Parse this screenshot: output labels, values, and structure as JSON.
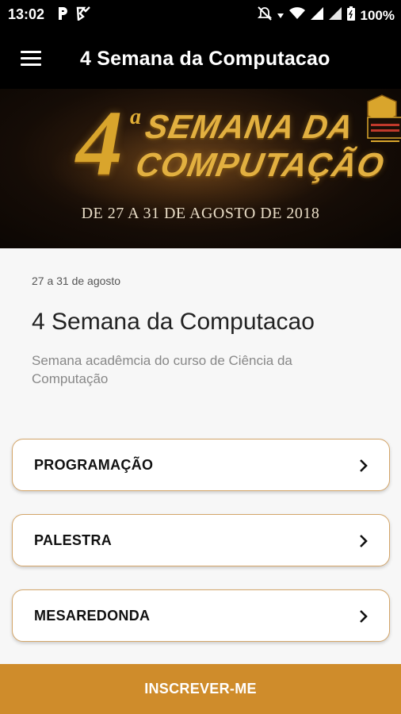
{
  "status_bar": {
    "time": "13:02",
    "left_icons": [
      "parking-icon",
      "notification-check-icon"
    ],
    "battery_text": "100%"
  },
  "app_bar": {
    "title": "4 Semana da Computacao",
    "menu_icon": "hamburger-menu-icon"
  },
  "banner": {
    "number": "4",
    "superscript": "a",
    "line1": "SEMANA DA",
    "line2": "COMPUTAÇÃO",
    "date_text": "DE 27 A 31 DE AGOSTO DE 2018"
  },
  "event": {
    "date": "27 a 31 de agosto",
    "title": "4 Semana da Computacao",
    "description": "Semana acadêmcia do curso de Ciência da Computação"
  },
  "menu": {
    "items": [
      {
        "label": "PROGRAMAÇÃO"
      },
      {
        "label": "PALESTRA"
      },
      {
        "label": "MESAREDONDA"
      }
    ]
  },
  "cta": {
    "label": "INSCREVER-ME"
  },
  "colors": {
    "accent": "#cf8c2b",
    "card_border": "#d4a66a",
    "app_bar": "#000000",
    "banner_gold": "#e2b040"
  }
}
